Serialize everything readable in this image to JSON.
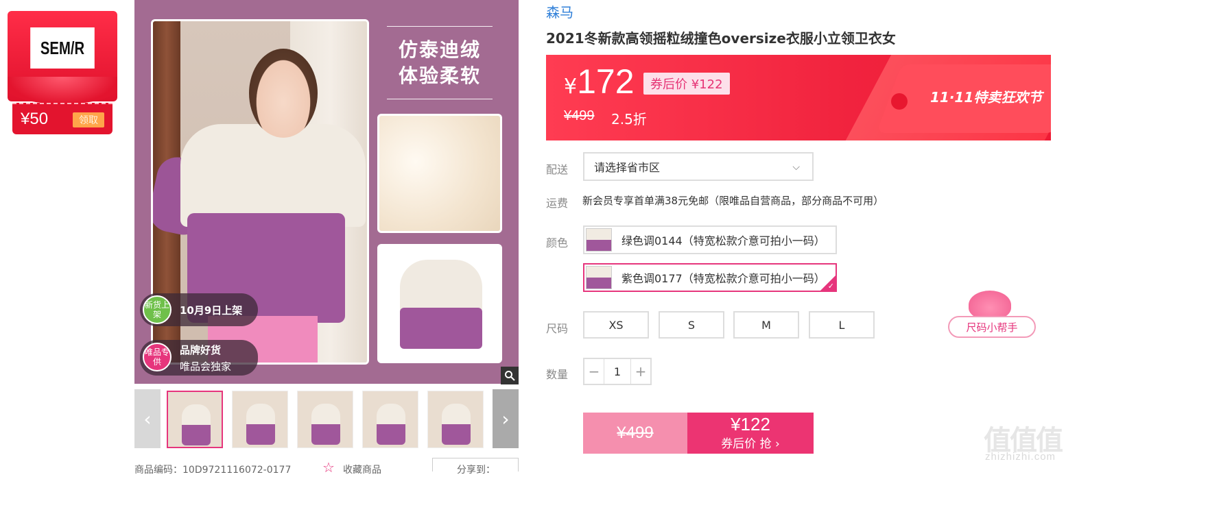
{
  "brand_coupon": {
    "logo_text": "SEM/R",
    "amount": "¥50",
    "claim_label": "领取"
  },
  "hero": {
    "headline_line1": "仿泰迪绒",
    "headline_line2": "体验柔软",
    "pill1_icon": "新货上架",
    "pill1_text": "10月9日上架",
    "pill2_icon": "唯品专供",
    "pill2_title": "品牌好货",
    "pill2_sub": "唯品会独家"
  },
  "footer": {
    "sku_label": "商品编码：10D9721116072-0177",
    "favorite_label": "收藏商品",
    "share_label": "分享到："
  },
  "product": {
    "brand": "森马",
    "title": "2021冬新款高领摇粒绒撞色oversize衣服小立领卫衣女"
  },
  "price": {
    "yen": "¥",
    "current": "172",
    "after_coupon": "券后价 ¥122",
    "original": "¥499",
    "discount": "2.5折",
    "festival": "11·11特卖狂欢节"
  },
  "delivery": {
    "label": "配送",
    "placeholder": "请选择省市区"
  },
  "shipping": {
    "label": "运费",
    "note": "新会员专享首单满38元免邮（限唯品自营商品，部分商品不可用）"
  },
  "colors": {
    "label": "颜色",
    "options": [
      {
        "name": "绿色调0144（特宽松款介意可拍小一码）"
      },
      {
        "name": "紫色调0177（特宽松款介意可拍小一码）"
      }
    ]
  },
  "sizes": {
    "label": "尺码",
    "options": [
      "XS",
      "S",
      "M",
      "L"
    ],
    "helper": "尺码小帮手"
  },
  "quantity": {
    "label": "数量",
    "value": "1",
    "minus": "−",
    "plus": "+"
  },
  "buy": {
    "original": "¥499",
    "price": "¥122",
    "label": "券后价 抢 ›"
  },
  "watermark": {
    "main": "值值值",
    "sub": "zhizhizhi.com"
  },
  "colors_theme": {
    "accent": "#e6357c",
    "banner": "#f1233e",
    "brand_link": "#2f7fd8"
  }
}
